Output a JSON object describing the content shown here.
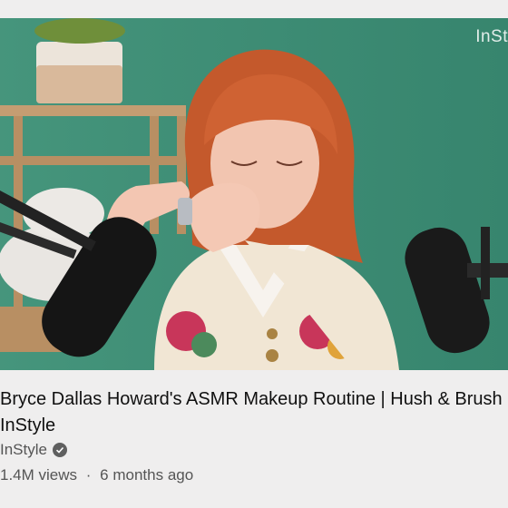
{
  "video": {
    "watermark": "InSt",
    "title_line1": "Bryce Dallas Howard's ASMR Makeup Routine | Hush & Brush",
    "title_line2": "InStyle",
    "channel": "InStyle",
    "views": "1.4M views",
    "separator": "·",
    "age": "6 months ago"
  },
  "icons": {
    "verified": "verified-check-icon"
  },
  "colors": {
    "background": "#eeeded",
    "thumbnail_wall": "#3f8f77",
    "title_text": "#101010",
    "secondary_text": "#555555"
  }
}
